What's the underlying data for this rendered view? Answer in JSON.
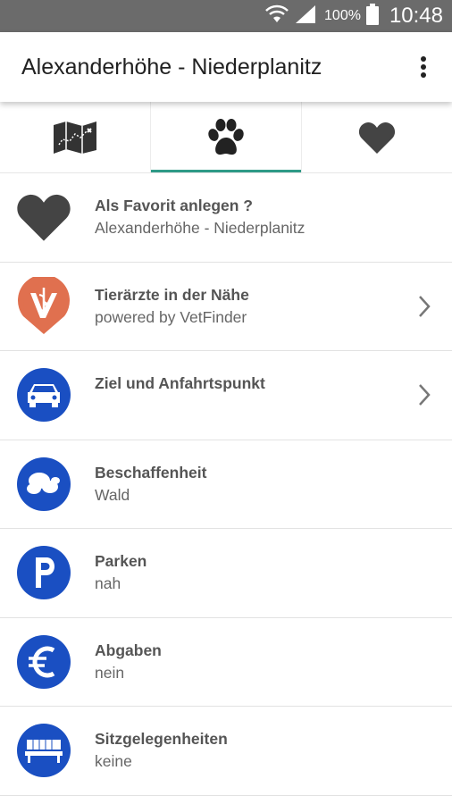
{
  "status_bar": {
    "battery_percent": "100%",
    "time": "10:48"
  },
  "app_bar": {
    "title": "Alexanderhöhe - Niederplanitz"
  },
  "tabs": [
    {
      "icon": "map-icon",
      "active": false
    },
    {
      "icon": "paw-icon",
      "active": true
    },
    {
      "icon": "heart-icon",
      "active": false
    }
  ],
  "accent_color": "#2e9a87",
  "icon_blue": "#1a4fc2",
  "rows": [
    {
      "icon": "heart-icon",
      "title": "Als Favorit anlegen ?",
      "subtitle": "Alexanderhöhe - Niederplanitz",
      "chevron": false
    },
    {
      "icon": "vetfinder-icon",
      "title": "Tierärzte in der Nähe",
      "subtitle": "powered by VetFinder",
      "chevron": true
    },
    {
      "icon": "car-icon",
      "title": "Ziel und Anfahrtspunkt",
      "subtitle": "",
      "chevron": true
    },
    {
      "icon": "terrain-icon",
      "title": "Beschaffenheit",
      "subtitle": "Wald",
      "chevron": false
    },
    {
      "icon": "parking-icon",
      "title": "Parken",
      "subtitle": "nah",
      "chevron": false
    },
    {
      "icon": "euro-icon",
      "title": "Abgaben",
      "subtitle": "nein",
      "chevron": false
    },
    {
      "icon": "bench-icon",
      "title": "Sitzgelegenheiten",
      "subtitle": "keine",
      "chevron": false
    }
  ]
}
